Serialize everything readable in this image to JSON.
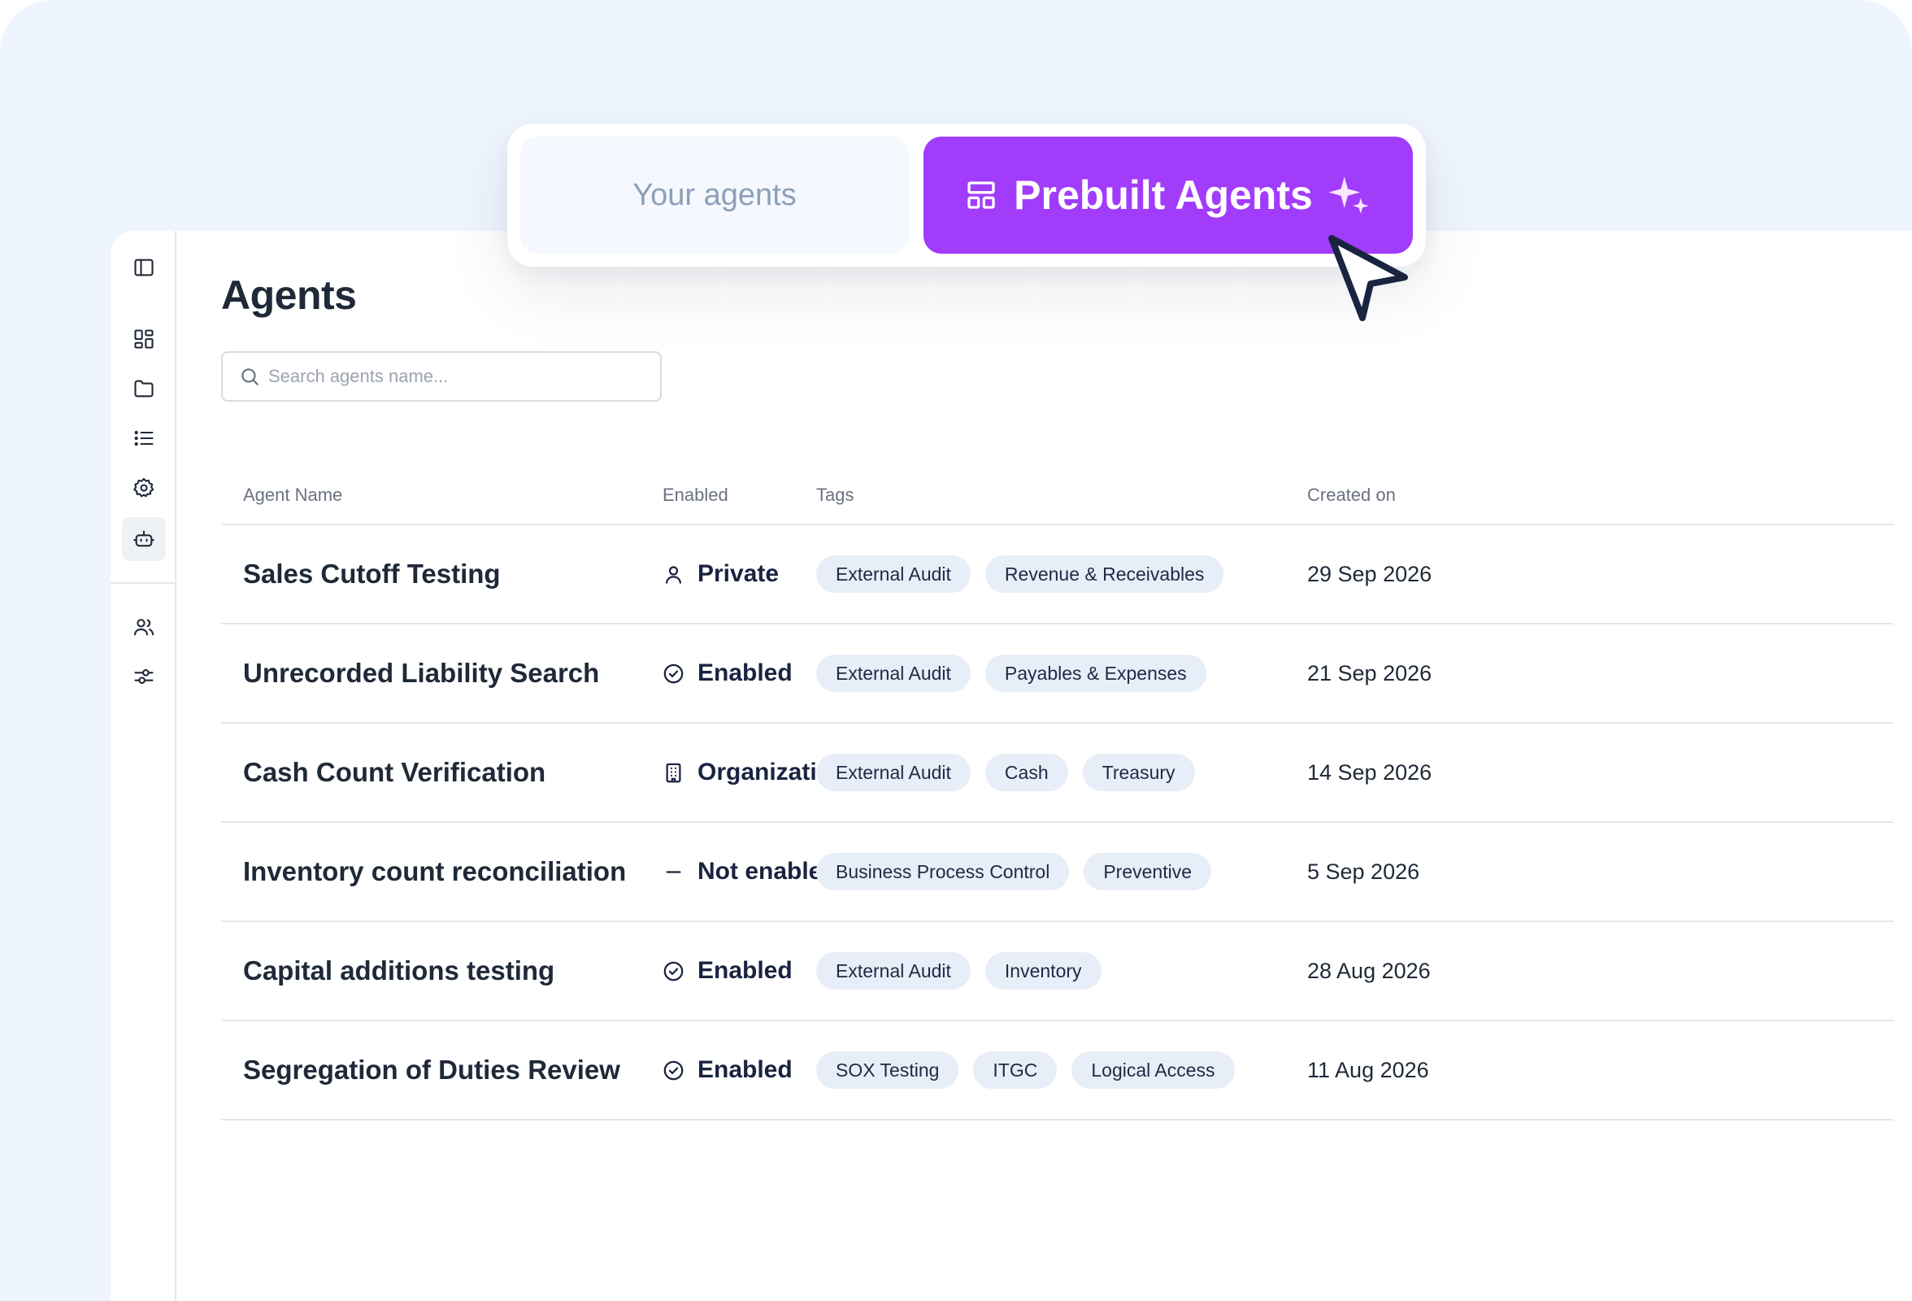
{
  "toggle": {
    "your_agents": "Your agents",
    "prebuilt_agents": "Prebuilt Agents"
  },
  "page": {
    "title": "Agents",
    "search_placeholder": "Search agents name..."
  },
  "sidebar": {
    "items": [
      {
        "icon": "panel-toggle-icon"
      },
      {
        "icon": "dashboard-icon"
      },
      {
        "icon": "folder-icon"
      },
      {
        "icon": "list-icon"
      },
      {
        "icon": "settings-icon"
      },
      {
        "icon": "bot-icon",
        "active": true
      },
      {
        "icon": "users-icon"
      },
      {
        "icon": "sliders-icon"
      }
    ]
  },
  "table": {
    "headers": {
      "name": "Agent Name",
      "enabled": "Enabled",
      "tags": "Tags",
      "created": "Created on"
    },
    "rows": [
      {
        "name": "Sales Cutoff Testing",
        "status": "Private",
        "status_icon": "user-icon",
        "tags": [
          "External Audit",
          "Revenue & Receivables"
        ],
        "created": "29 Sep 2026"
      },
      {
        "name": "Unrecorded Liability Search",
        "status": "Enabled",
        "status_icon": "check-circle-icon",
        "tags": [
          "External Audit",
          "Payables & Expenses"
        ],
        "created": "21 Sep 2026"
      },
      {
        "name": "Cash Count Verification",
        "status": "Organization",
        "status_icon": "building-icon",
        "tags": [
          "External Audit",
          "Cash",
          "Treasury"
        ],
        "created": "14 Sep 2026"
      },
      {
        "name": "Inventory count reconciliation",
        "status": "Not enabled",
        "status_icon": "minus-icon",
        "tags": [
          "Business Process Control",
          "Preventive"
        ],
        "created": "5 Sep 2026"
      },
      {
        "name": "Capital additions testing",
        "status": "Enabled",
        "status_icon": "check-circle-icon",
        "tags": [
          "External Audit",
          "Inventory"
        ],
        "created": "28 Aug 2026"
      },
      {
        "name": "Segregation of Duties Review",
        "status": "Enabled",
        "status_icon": "check-circle-icon",
        "tags": [
          "SOX Testing",
          "ITGC",
          "Logical Access"
        ],
        "created": "11 Aug 2026"
      }
    ]
  },
  "colors": {
    "accent": "#a13cfb",
    "backdrop": "#eff5fe",
    "tag_bg": "#e8eef8"
  }
}
